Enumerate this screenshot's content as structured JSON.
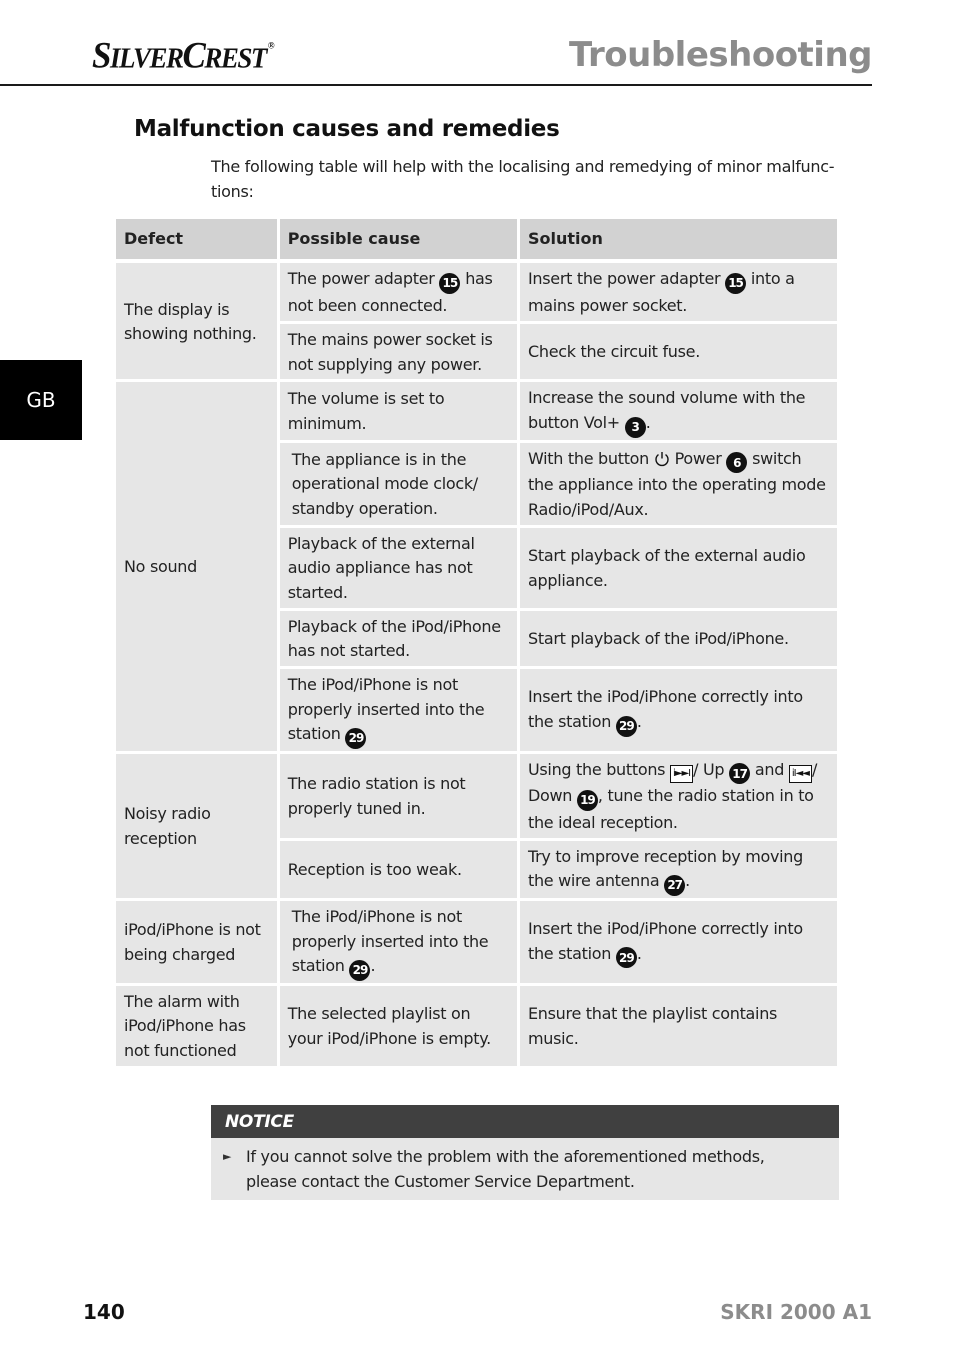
{
  "header": {
    "brand": "SilverCrest",
    "brand_s": "S",
    "brand_ilver": "ILVER",
    "brand_c": "C",
    "brand_rest": "REST",
    "registered": "®",
    "page_title": "Troubleshooting"
  },
  "side_tab": {
    "language": "GB"
  },
  "section": {
    "title": "Malfunction causes and remedies",
    "intro": "The following table will help with the localising and remedying of minor malfunc-tions:"
  },
  "table": {
    "headers": {
      "defect": "Defect",
      "cause": "Possible cause",
      "solution": "Solution"
    },
    "groups": [
      {
        "defect": "The display is showing nothing.",
        "rows": [
          {
            "cause_pre": "The power adapter",
            "cause_ref": "15",
            "cause_post": "has not been connected.",
            "solution_pre": "Insert the power adapter",
            "solution_ref": "15",
            "solution_post": "into a mains power socket."
          },
          {
            "cause": "The mains power socket is not supplying any power.",
            "solution": "Check the circuit fuse."
          }
        ]
      },
      {
        "defect": "No sound",
        "rows": [
          {
            "cause": "The volume is set to minimum.",
            "solution_pre": "Increase the sound volume with the button Vol+",
            "solution_ref": "3",
            "solution_post": "."
          },
          {
            "cause": "The appliance is in the operational mode clock/ standby operation.",
            "solution_pre": "With the button",
            "solution_icon": "power-icon",
            "solution_mid": "Power",
            "solution_ref": "6",
            "solution_post": "switch the appliance into the operating mode Radio/iPod/Aux."
          },
          {
            "cause": "Playback of the external audio appliance has not started.",
            "solution": "Start playback of the external audio appliance."
          },
          {
            "cause": "Playback of the iPod/iPhone has not started.",
            "solution": "Start playback of the iPod/iPhone."
          },
          {
            "cause_pre": "The iPod/iPhone is not properly inserted into the station",
            "cause_ref": "29",
            "solution_pre": "Insert the iPod/iPhone correctly into the station",
            "solution_ref": "29",
            "solution_post": "."
          }
        ]
      },
      {
        "defect": "Noisy radio reception",
        "rows": [
          {
            "cause": "The radio station is not properly tuned in.",
            "solution_pre": "Using the buttons",
            "key_up": "i►►I",
            "up_label": "/ Up",
            "up_ref": "17",
            "and": "and",
            "key_down": "iI◄◄",
            "down_label": "/ Down",
            "down_ref": "19",
            "solution_post": ", tune the radio station in to the ideal reception."
          },
          {
            "cause": "Reception is too weak.",
            "solution_pre": "Try to improve reception by moving the wire antenna",
            "solution_ref": "27",
            "solution_post": "."
          }
        ]
      },
      {
        "defect": "iPod/iPhone is not being charged",
        "rows": [
          {
            "cause_pre": "The iPod/iPhone is not properly inserted into the station",
            "cause_ref": "29",
            "cause_post": ".",
            "solution_pre": "Insert the iPod/iPhone correctly into the station",
            "solution_ref": "29",
            "solution_post": "."
          }
        ]
      },
      {
        "defect": "The alarm with iPod/iPhone has not functioned",
        "rows": [
          {
            "cause": "The selected playlist on your iPod/iPhone is empty.",
            "solution": "Ensure that the playlist contains music."
          }
        ]
      }
    ]
  },
  "notice": {
    "title": "NOTICE",
    "bullet": "►",
    "text": "If you cannot solve the problem with the aforementioned methods, please contact the Customer Service Department."
  },
  "footer": {
    "page_number": "140",
    "model": "SKRI 2000 A1"
  }
}
